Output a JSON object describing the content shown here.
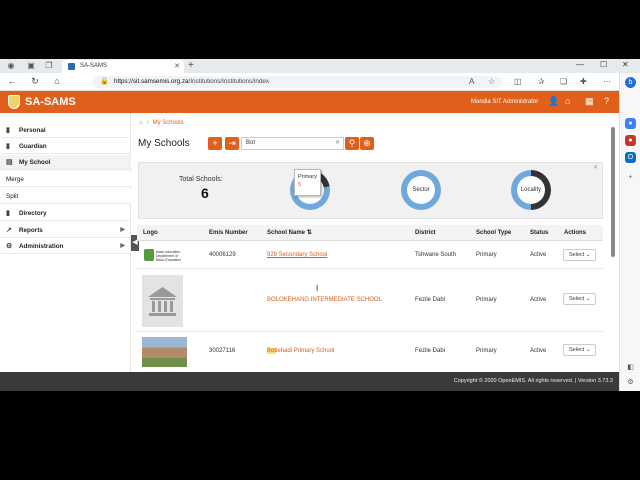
{
  "browser": {
    "tab_title": "SA-SAMS",
    "url_host": "https://sit.samsemis.org.za",
    "url_path": "/Institutions/Institutions/index"
  },
  "app": {
    "name": "SA-SAMS",
    "user": "Mandla SIT  Administrator"
  },
  "nav": {
    "items": [
      {
        "label": "Personal",
        "icon": "user-icon"
      },
      {
        "label": "Guardian",
        "icon": "users-icon"
      },
      {
        "label": "My School",
        "icon": "school-icon"
      },
      {
        "label": "Merge"
      },
      {
        "label": "Split"
      },
      {
        "label": "Directory",
        "icon": "book-icon"
      },
      {
        "label": "Reports",
        "icon": "chart-icon"
      },
      {
        "label": "Administration",
        "icon": "cogs-icon"
      }
    ]
  },
  "breadcrumb": {
    "current": "My Schools"
  },
  "page": {
    "title": "My Schools",
    "search_value": "Bot"
  },
  "stats": {
    "total_label": "Total Schools:",
    "total_value": "6",
    "charts": [
      {
        "label": "Primary",
        "value": "5"
      },
      {
        "label": "Sector"
      },
      {
        "label": "Locality"
      }
    ],
    "tooltip_label": "Primary",
    "tooltip_value": "5"
  },
  "table": {
    "headers": [
      "Logo",
      "Emis Number",
      "School Name",
      "District",
      "School Type",
      "Status",
      "Actions"
    ],
    "rows": [
      {
        "emis": "40006129",
        "name": "929 Secondary School",
        "district": "Tshwane South",
        "type": "Primary",
        "status": "Active",
        "action": "Select"
      },
      {
        "emis": "",
        "name": "BOLOKEHANG INTERMEDIATE SCHOOL",
        "district": "Fezile Dabi",
        "type": "Primary",
        "status": "Active",
        "action": "Select"
      },
      {
        "emis": "30027116",
        "name_hl": "Bot",
        "name_rest": "lehadi Primary School",
        "district": "Fezile Dabi",
        "type": "Primary",
        "status": "Active",
        "action": "Select"
      }
    ]
  },
  "footer": {
    "text": "Copyright © 2020 OpenEMIS. All rights reserved. | Version 3.73.3"
  },
  "colors": {
    "brand": "#e0601b",
    "donut": "#6fa8dc"
  }
}
